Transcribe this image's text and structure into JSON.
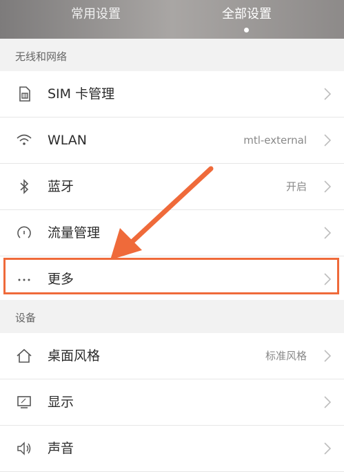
{
  "tabs": [
    {
      "label": "常用设置"
    },
    {
      "label": "全部设置"
    }
  ],
  "sections": [
    {
      "header": "无线和网络",
      "items": [
        {
          "label": "SIM 卡管理",
          "value": "",
          "icon": "sim-card-icon"
        },
        {
          "label": "WLAN",
          "value": "mtl-external",
          "icon": "wifi-icon"
        },
        {
          "label": "蓝牙",
          "value": "开启",
          "icon": "bluetooth-icon"
        },
        {
          "label": "流量管理",
          "value": "",
          "icon": "data-usage-icon"
        },
        {
          "label": "更多",
          "value": "",
          "icon": "more-dots-icon"
        }
      ]
    },
    {
      "header": "设备",
      "items": [
        {
          "label": "桌面风格",
          "value": "标准风格",
          "icon": "home-icon"
        },
        {
          "label": "显示",
          "value": "",
          "icon": "display-icon"
        },
        {
          "label": "声音",
          "value": "",
          "icon": "sound-icon"
        }
      ]
    }
  ],
  "colors": {
    "highlight": "#ef6a3a",
    "topbar": "#a9a6a4"
  }
}
